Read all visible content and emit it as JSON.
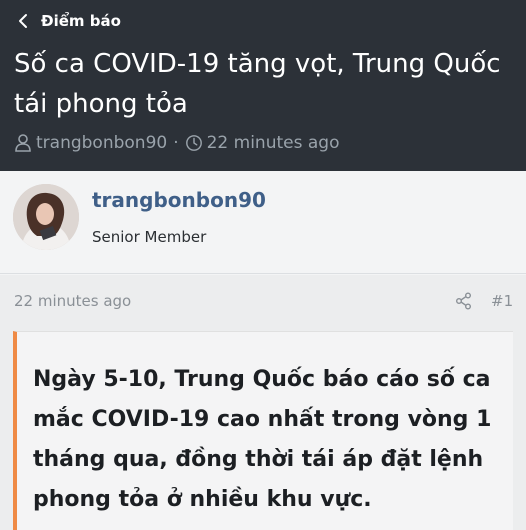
{
  "header": {
    "breadcrumb": "Điểm báo",
    "title": "Số ca COVID-19 tăng vọt, Trung Quốc tái phong tỏa",
    "author": "trangbonbon90",
    "separator": "·",
    "time": "22 minutes ago"
  },
  "author_block": {
    "username": "trangbonbon90",
    "user_title": "Senior Member"
  },
  "post": {
    "timestamp": "22 minutes ago",
    "post_number": "#1",
    "lead_text": "Ngày 5-10, Trung Quốc báo cáo số ca mắc COVID-19 cao nhất trong vòng 1 tháng qua, đồng thời tái áp đặt lệnh phong tỏa ở nhiều khu vực."
  },
  "colors": {
    "header_bg": "#2c3138",
    "username": "#3f5f88",
    "quote_border": "#ef8a45"
  }
}
